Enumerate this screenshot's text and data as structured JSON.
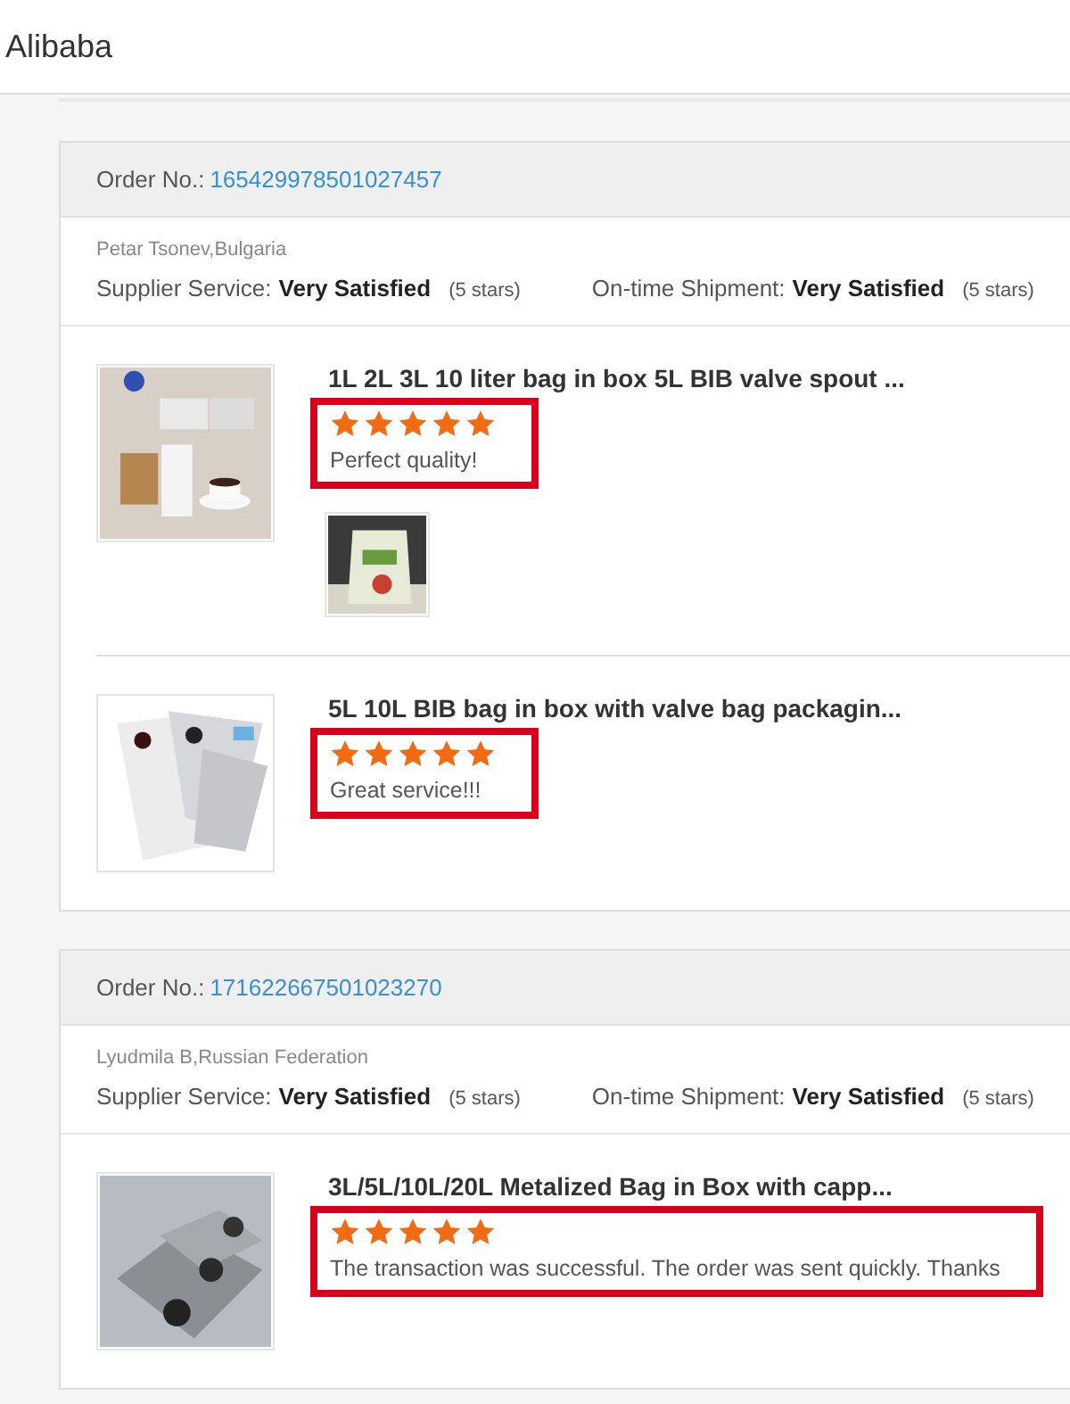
{
  "header": {
    "title": "Alibaba"
  },
  "orders": [
    {
      "order_label": "Order No.:",
      "order_number": "165429978501027457",
      "buyer": "Petar Tsonev,Bulgaria",
      "ratings": [
        {
          "label": "Supplier Service:",
          "value": "Very Satisfied",
          "stars_text": "(5 stars)"
        },
        {
          "label": "On-time Shipment:",
          "value": "Very Satisfied",
          "stars_text": "(5 stars)"
        }
      ],
      "products": [
        {
          "title": "1L 2L 3L 10 liter bag in box 5L BIB valve spout ...",
          "stars": 5,
          "comment": "Perfect quality!",
          "photos": [
            {
              "kind": "picture"
            }
          ]
        },
        {
          "title": "5L 10L BIB bag in box with valve bag packagin...",
          "stars": 5,
          "comment": "Great service!!!"
        }
      ]
    },
    {
      "order_label": "Order No.:",
      "order_number": "171622667501023270",
      "buyer": "Lyudmila B,Russian Federation",
      "ratings": [
        {
          "label": "Supplier Service:",
          "value": "Very Satisfied",
          "stars_text": "(5 stars)"
        },
        {
          "label": "On-time Shipment:",
          "value": "Very Satisfied",
          "stars_text": "(5 stars)"
        }
      ],
      "products": [
        {
          "title": "3L/5L/10L/20L Metalized Bag in Box with capp...",
          "stars": 5,
          "comment": "The transaction was successful. The order was sent quickly. Thanks"
        }
      ]
    }
  ]
}
